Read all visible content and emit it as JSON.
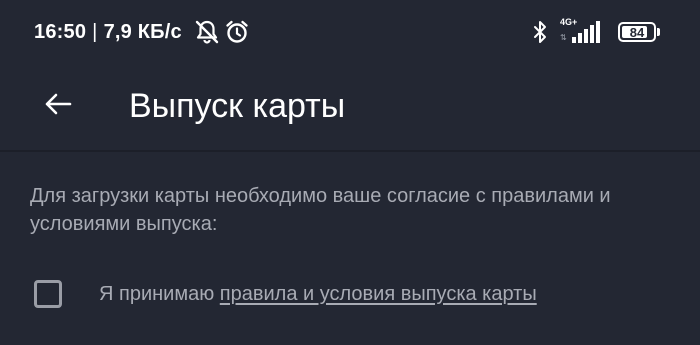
{
  "status_bar": {
    "time": "16:50",
    "separator": "|",
    "network_speed": "7,9 КБ/с",
    "icons": [
      "notifications-off-icon",
      "alarm-icon",
      "bluetooth-icon",
      "signal-4g-icon",
      "battery-icon"
    ],
    "network_type": "4G+",
    "battery_level": "84",
    "battery_fraction": 0.84
  },
  "app_bar": {
    "back_icon": "arrow-left-icon",
    "title": "Выпуск карты"
  },
  "content": {
    "consent_text": "Для загрузки карты необходимо ваше согласие с правилами и условиями выпуска:",
    "checkbox_checked": false,
    "agree_prefix": "Я принимаю ",
    "agree_link": "правила и условия выпуска карты"
  },
  "colors": {
    "background": "#232733",
    "title_text": "#ffffff",
    "secondary_text": "#a8abb4",
    "checkbox_border": "#9a9da6"
  }
}
